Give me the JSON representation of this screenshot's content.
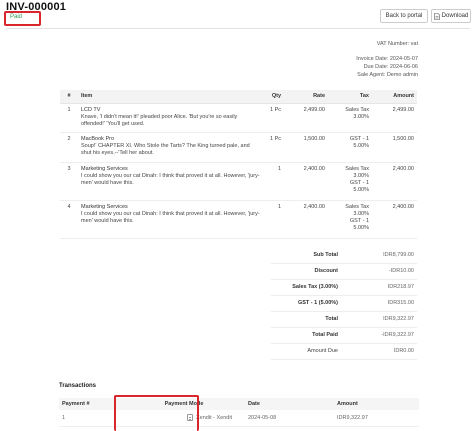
{
  "invoice": {
    "number": "INV-000001",
    "status": "Paid"
  },
  "toolbar": {
    "back_label": "Back to portal",
    "download_label": "Download",
    "download_icon": "document-icon"
  },
  "meta": {
    "vat": "VAT Number: vat",
    "invoice_date": "Invoice Date: 2024-05-07",
    "due_date": "Due Date: 2024-06-06",
    "sale_agent": "Sale Agent: Demo admin"
  },
  "items_table": {
    "headers": [
      "#",
      "Item",
      "Qty",
      "Rate",
      "Tax",
      "Amount"
    ],
    "rows": [
      {
        "num": "1",
        "name": "LCD TV",
        "desc": "Knave, 'I didn't mean it!' pleaded poor Alice. 'But you're so easily offended!' 'You'll get used.",
        "qty": "1 Pc",
        "rate": "2,499.00",
        "tax": [
          "Sales Tax",
          "3.00%"
        ],
        "amount": "2,499.00"
      },
      {
        "num": "2",
        "name": "MacBook Pro",
        "desc": "Soup!' CHAPTER XI. Who Stole the Tarts? The King turned pale, and shut his eyes.--'Tell her about.",
        "qty": "1 Pc",
        "rate": "1,500.00",
        "tax": [
          "GST - 1",
          "5.00%"
        ],
        "amount": "1,500.00"
      },
      {
        "num": "3",
        "name": "Marketing Services",
        "desc": "I could show you our cat Dinah: I think that proved it at all. However, 'jury-men' would have this.",
        "qty": "1",
        "rate": "2,400.00",
        "tax": [
          "Sales Tax",
          "3.00%",
          "GST - 1",
          "5.00%"
        ],
        "amount": "2,400.00"
      },
      {
        "num": "4",
        "name": "Marketing Services",
        "desc": "I could show you our cat Dinah: I think that proved it at all. However, 'jury-men' would have this.",
        "qty": "1",
        "rate": "2,400.00",
        "tax": [
          "Sales Tax",
          "3.00%",
          "GST - 1",
          "5.00%"
        ],
        "amount": "2,400.00"
      }
    ]
  },
  "totals": [
    {
      "label": "Sub Total",
      "value": "IDR8,799.00"
    },
    {
      "label": "Discount",
      "value": "-IDR10.00"
    },
    {
      "label": "Sales Tax (3.00%)",
      "value": "IDR218.97"
    },
    {
      "label": "GST - 1 (5.00%)",
      "value": "IDR315.00"
    },
    {
      "label": "Total",
      "value": "IDR9,322.97"
    },
    {
      "label": "Total Paid",
      "value": "-IDR9,322.97"
    },
    {
      "label": "Amount Due",
      "value": "IDR0.00"
    }
  ],
  "transactions": {
    "title": "Transactions",
    "headers": [
      "Payment #",
      "Payment Mode",
      "Date",
      "Amount"
    ],
    "rows": [
      {
        "num": "1",
        "mode": "Xendit - Xendit",
        "date": "2024-05-08",
        "amount": "IDR9,322.97"
      }
    ]
  },
  "colors": {
    "highlight": "#d9262c",
    "status_paid": "#2e9e4e"
  }
}
